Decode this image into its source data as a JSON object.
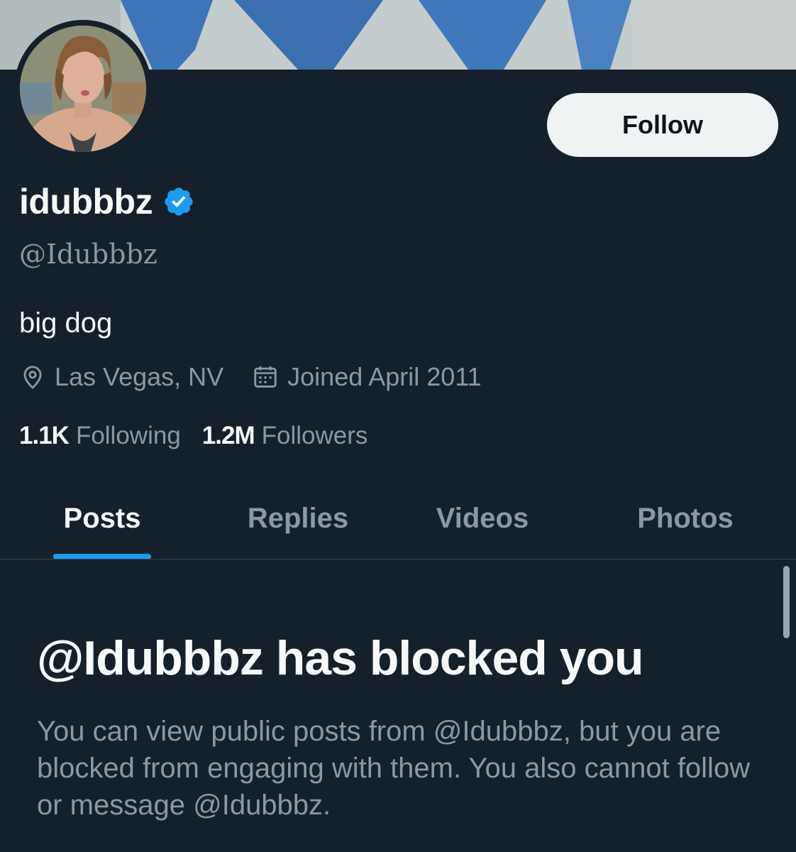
{
  "profile": {
    "display_name": "idubbbz",
    "verified": true,
    "handle": "@Idubbbz",
    "bio": "big dog",
    "location": "Las Vegas, NV",
    "joined": "Joined April 2011",
    "following_count": "1.1K",
    "following_label": "Following",
    "followers_count": "1.2M",
    "followers_label": "Followers"
  },
  "actions": {
    "follow_label": "Follow"
  },
  "tabs": [
    {
      "label": "Posts",
      "active": true
    },
    {
      "label": "Replies",
      "active": false
    },
    {
      "label": "Videos",
      "active": false
    },
    {
      "label": "Photos",
      "active": false
    }
  ],
  "blocked": {
    "title": "@Idubbbz has blocked you",
    "description": "You can view public posts from @Idubbbz, but you are blocked from engaging with them. You also cannot follow or message @Idubbbz."
  },
  "colors": {
    "background": "#15202b",
    "accent": "#1d9bf0",
    "secondary_text": "#8b98a5",
    "primary_text": "#f7f9f9",
    "button_bg": "#eff3f4"
  },
  "icons": [
    "verified-badge-icon",
    "location-pin-icon",
    "calendar-icon"
  ]
}
